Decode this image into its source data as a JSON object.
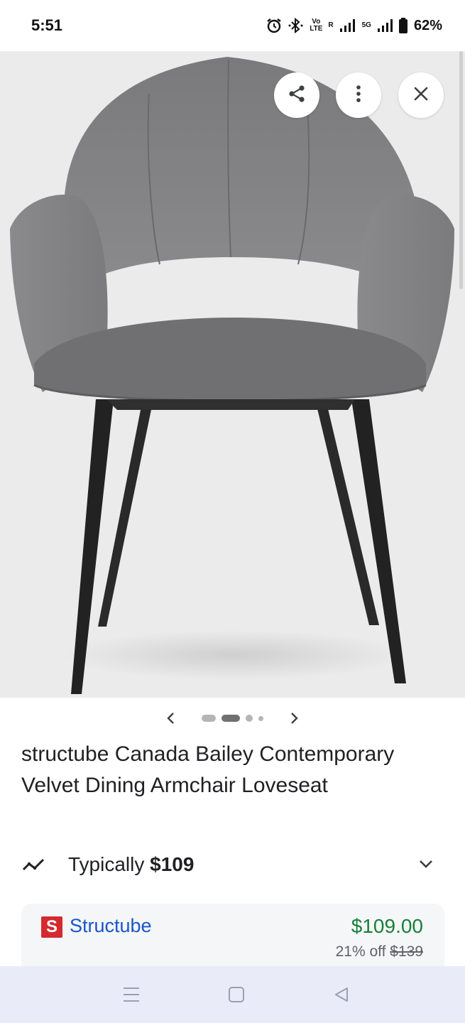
{
  "status_bar": {
    "time": "5:51",
    "network_label_top": "Vo",
    "network_label_bottom": "LTE",
    "roaming": "R",
    "signal_5g": "5G",
    "battery": "62%"
  },
  "product": {
    "title": "structube Canada Bailey Contemporary Velvet Dining Armchair Loveseat",
    "image_index": 2,
    "image_count": 4
  },
  "price_tracking": {
    "label": "Typically",
    "value": "$109"
  },
  "offer": {
    "store_logo_letter": "S",
    "store": "Structube",
    "price": "$109.00",
    "discount": "21% off",
    "original_price": "$139"
  },
  "colors": {
    "price_green": "#188038",
    "store_blue": "#1a55c9",
    "logo_red": "#d42a2f"
  },
  "icons": [
    "share-icon",
    "more-vert-icon",
    "close-icon",
    "chevron-left-icon",
    "chevron-right-icon",
    "trend-icon",
    "chevron-down-icon",
    "recents-icon",
    "home-icon",
    "back-icon"
  ]
}
